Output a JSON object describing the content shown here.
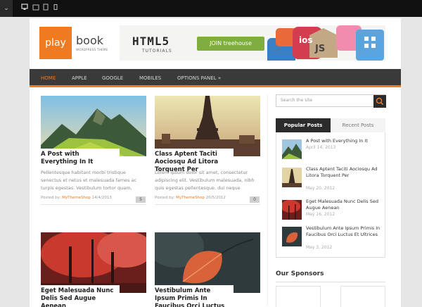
{
  "toolbar": {
    "buttons": [
      {
        "icon": "chevron-down-icon"
      },
      {
        "icon": "desktop-icon"
      },
      {
        "icon": "tablet-landscape-icon"
      },
      {
        "icon": "tablet-portrait-icon"
      },
      {
        "icon": "phone-icon"
      }
    ]
  },
  "header": {
    "logo_box": "play",
    "logo_word": "book",
    "logo_sub": "WORDPRESS THEME",
    "ad": {
      "heading": "HTML5",
      "subheading": "TUTORIALS",
      "button": "JOIN treehouse",
      "tiles": [
        "ios",
        "JS"
      ]
    }
  },
  "nav": {
    "items": [
      {
        "label": "HOME",
        "active": true
      },
      {
        "label": "APPLE",
        "active": false
      },
      {
        "label": "GOOGLE",
        "active": false
      },
      {
        "label": "MOBILES",
        "active": false
      },
      {
        "label": "OPTIONS PANEL »",
        "active": false
      }
    ]
  },
  "posts": [
    {
      "title": "A Post with Everything In It",
      "excerpt": "Pellentesque habitant morbi tristique senectus et netus et malesuada fames ac turpis egestas. Vestibulum tortor quam,",
      "posted_by": "Posted by:",
      "author": "MyThemeShop",
      "date": "14/4/2013",
      "comments": "5",
      "thumb": "mountain"
    },
    {
      "title": "Class Aptent Taciti Aociosqu Ad Litora Torquent Per",
      "excerpt": "Lorem ipsum dolor sit amet, consectetur adipiscing elit. Vestibulum malesuada, nibh quis egestas pellentesque, dui neque",
      "posted_by": "Posted by:",
      "author": "MyThemeShop",
      "date": "20/5/2012",
      "comments": "0",
      "thumb": "eiffel"
    },
    {
      "title": "Eget Malesuada Nunc Delis Sed Augue Aenean",
      "thumb": "red-forest"
    },
    {
      "title": "Vestibulum Ante Ipsum Primis In Faucibus Orci Luctus",
      "thumb": "leaf"
    }
  ],
  "sidebar": {
    "search_placeholder": "Search the site",
    "tab_popular": "Popular Posts",
    "tab_recent": "Recent Posts",
    "popular": [
      {
        "title": "A Post with Everything In It",
        "date": "April 14, 2013",
        "thumb": "mountain"
      },
      {
        "title": "Class Aptent Taciti Aociosqu Ad Litora Torquent Per",
        "date": "May 20, 2012",
        "thumb": "eiffel"
      },
      {
        "title": "Eget Malesuada Nunc Delis Sed Augue Aenean",
        "date": "May 16, 2012",
        "thumb": "red-forest"
      },
      {
        "title": "Vestibulum Ante Ipsum Primis In Faucibus Orci Luctus Et Ultrices",
        "date": "May 3, 2012",
        "thumb": "leaf"
      }
    ],
    "sponsors_title": "Our Sponsors"
  },
  "colors": {
    "accent": "#f07a20",
    "nav": "#3a3a3a",
    "tab_active": "#2b2b2b",
    "ad_button": "#7fae3e"
  }
}
